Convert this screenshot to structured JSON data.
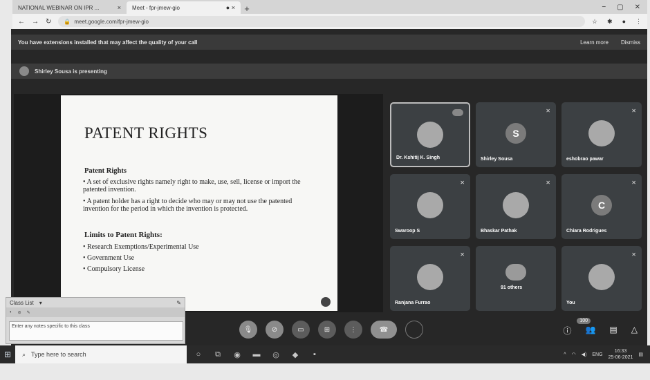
{
  "browser": {
    "tabs": [
      {
        "title": "NATIONAL WEBINAR ON IPR ..."
      },
      {
        "title": "Meet - fpr-jmew-gio"
      }
    ],
    "url": "meet.google.com/fpr-jmew-gio"
  },
  "meet": {
    "banner": {
      "text": "You have extensions installed that may affect the quality of your call",
      "learn_more": "Learn more",
      "dismiss": "Dismiss"
    },
    "presenting": "Shirley Sousa is presenting",
    "slide": {
      "title": "PATENT RIGHTS",
      "heading": "Patent Rights",
      "bullet1": "• A set of exclusive rights namely right to make, use, sell, license or import the patented invention.",
      "bullet2": "• A patent holder has a right to decide who may or may not use the patented invention for the period in which the invention is protected.",
      "limits_heading": "Limits to Patent Rights:",
      "limit1": "• Research Exemptions/Experimental Use",
      "limit2": "• Government Use",
      "limit3": "• Compulsory License"
    },
    "participants": [
      {
        "name": "Dr. Kshitij K. Singh"
      },
      {
        "name": "Shirley Sousa",
        "initial": "S"
      },
      {
        "name": "eshobrao pawar"
      },
      {
        "name": "Swaroop S"
      },
      {
        "name": "Bhaskar Pathak"
      },
      {
        "name": "Chiara Rodrigues",
        "initial": "C"
      },
      {
        "name": "Ranjana Furrao"
      },
      {
        "name": "91 others"
      },
      {
        "name": "You"
      }
    ],
    "people_count": "100"
  },
  "class_list": {
    "label": "Class List",
    "notes_placeholder": "Enter any notes specific to this class"
  },
  "taskbar": {
    "search_placeholder": "Type here to search",
    "lang": "ENG",
    "time": "16:33",
    "date": "25-06-2021"
  }
}
